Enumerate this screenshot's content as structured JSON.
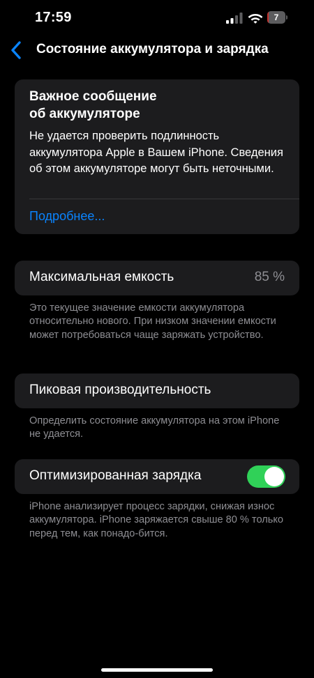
{
  "status_bar": {
    "time": "17:59",
    "battery_level": "7",
    "battery_color": "#c9302c",
    "icons": [
      "signal-icon",
      "wifi-icon",
      "battery-icon"
    ]
  },
  "nav": {
    "back_icon": "chevron-left-icon",
    "title": "Состояние аккумулятора и зарядка"
  },
  "alert": {
    "title_line1": "Важное сообщение",
    "title_line2": "об аккумуляторе",
    "body": "Не удается проверить подлинность аккумулятора Apple в Вашем iPhone. Сведения об этом аккумуляторе могут быть неточными.",
    "link": "Подробнее..."
  },
  "max_capacity": {
    "label": "Максимальная емкость",
    "value": "85 %",
    "footnote": "Это текущее значение емкости аккумулятора относительно нового. При низком значении емкости может потребоваться чаще заряжать устройство."
  },
  "peak_performance": {
    "label": "Пиковая производительность",
    "footnote": "Определить состояние аккумулятора на этом iPhone не удается."
  },
  "optimized_charging": {
    "label": "Оптимизированная зарядка",
    "enabled": true,
    "toggle_color": "#30d158",
    "footnote": "iPhone анализирует процесс зарядки, снижая износ аккумулятора. iPhone заряжается свыше 80 % только перед тем, как понадо-бится."
  },
  "colors": {
    "background": "#000000",
    "card": "#1c1c1e",
    "accent": "#0a84ff",
    "secondary_text": "#8e8e93"
  }
}
